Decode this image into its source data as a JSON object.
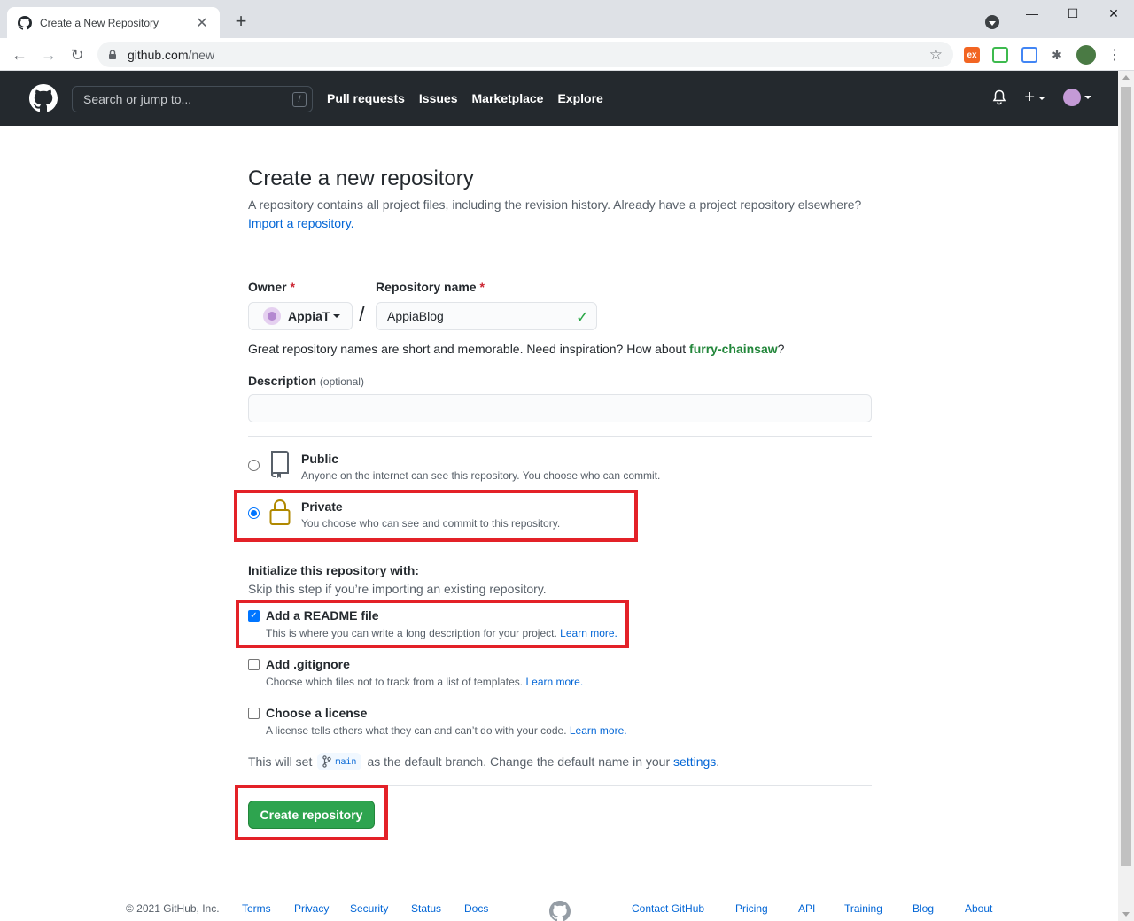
{
  "browser": {
    "tab_title": "Create a New Repository",
    "url_host": "github.com",
    "url_path": "/new"
  },
  "header": {
    "search_placeholder": "Search or jump to...",
    "search_shortcut": "/",
    "nav": [
      "Pull requests",
      "Issues",
      "Marketplace",
      "Explore"
    ]
  },
  "page": {
    "title": "Create a new repository",
    "subtitle": "A repository contains all project files, including the revision history. Already have a project repository elsewhere?",
    "import_link": "Import a repository.",
    "owner_label": "Owner",
    "owner_value": "AppiaT",
    "repo_label": "Repository name",
    "repo_value": "AppiaBlog",
    "required_mark": "*",
    "separator": "/",
    "hint_prefix": "Great repository names are short and memorable. Need inspiration? How about ",
    "hint_suggestion": "furry-chainsaw",
    "hint_suffix": "?",
    "description_label": "Description",
    "description_optional": "(optional)",
    "description_value": ""
  },
  "visibility": {
    "public": {
      "title": "Public",
      "desc": "Anyone on the internet can see this repository. You choose who can commit.",
      "checked": false
    },
    "private": {
      "title": "Private",
      "desc": "You choose who can see and commit to this repository.",
      "checked": true
    }
  },
  "init": {
    "title": "Initialize this repository with:",
    "subtitle": "Skip this step if you’re importing an existing repository.",
    "readme": {
      "title": "Add a README file",
      "desc": "This is where you can write a long description for your project.",
      "link": "Learn more.",
      "checked": true
    },
    "gitignore": {
      "title": "Add .gitignore",
      "desc": "Choose which files not to track from a list of templates.",
      "link": "Learn more.",
      "checked": false
    },
    "license": {
      "title": "Choose a license",
      "desc": "A license tells others what they can and can’t do with your code.",
      "link": "Learn more.",
      "checked": false
    }
  },
  "branch": {
    "prefix": "This will set",
    "name": "main",
    "middle": "as the default branch. Change the default name in your",
    "link": "settings",
    "suffix": "."
  },
  "create_button": "Create repository",
  "footer": {
    "copyright": "© 2021 GitHub, Inc.",
    "left_links": [
      "Terms",
      "Privacy",
      "Security",
      "Status",
      "Docs"
    ],
    "right_links": [
      "Contact GitHub",
      "Pricing",
      "API",
      "Training",
      "Blog",
      "About"
    ]
  },
  "colors": {
    "header_bg": "#24292e",
    "primary_green": "#2ea44f",
    "link_blue": "#0366d6",
    "highlight_red": "#e32128"
  }
}
